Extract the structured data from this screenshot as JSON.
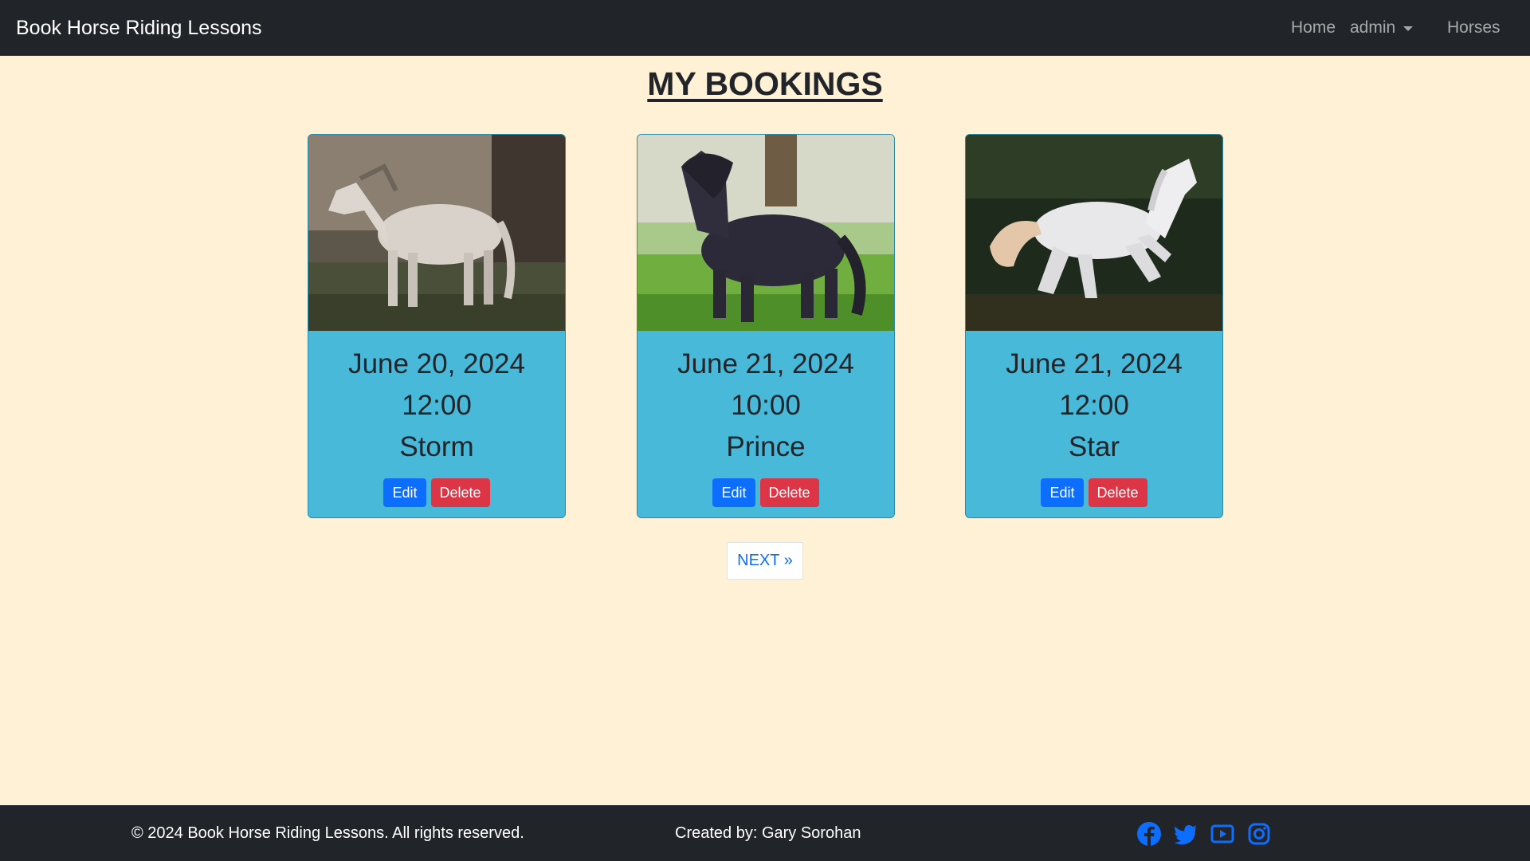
{
  "navbar": {
    "brand": "Book Horse Riding Lessons",
    "home": "Home",
    "user": "admin",
    "horses": "Horses"
  },
  "page": {
    "title": "MY BOOKINGS"
  },
  "bookings": [
    {
      "date": "June 20, 2024",
      "time": "12:00",
      "horse": "Storm",
      "edit_label": "Edit",
      "delete_label": "Delete",
      "image": "grey-horse-photo"
    },
    {
      "date": "June 21, 2024",
      "time": "10:00",
      "horse": "Prince",
      "edit_label": "Edit",
      "delete_label": "Delete",
      "image": "black-pony-photo"
    },
    {
      "date": "June 21, 2024",
      "time": "12:00",
      "horse": "Star",
      "edit_label": "Edit",
      "delete_label": "Delete",
      "image": "white-horse-photo"
    }
  ],
  "pagination": {
    "next_label": "NEXT »"
  },
  "footer": {
    "copyright": "© 2024 Book Horse Riding Lessons. All rights reserved.",
    "credit": "Created by: Gary Sorohan",
    "socials": [
      "facebook-icon",
      "twitter-icon",
      "youtube-icon",
      "instagram-icon"
    ]
  },
  "colors": {
    "background": "#fff1d6",
    "navbar": "#212529",
    "card": "#49b9d9",
    "edit": "#0d6efd",
    "delete": "#dc3545",
    "social": "#0d6efd"
  }
}
